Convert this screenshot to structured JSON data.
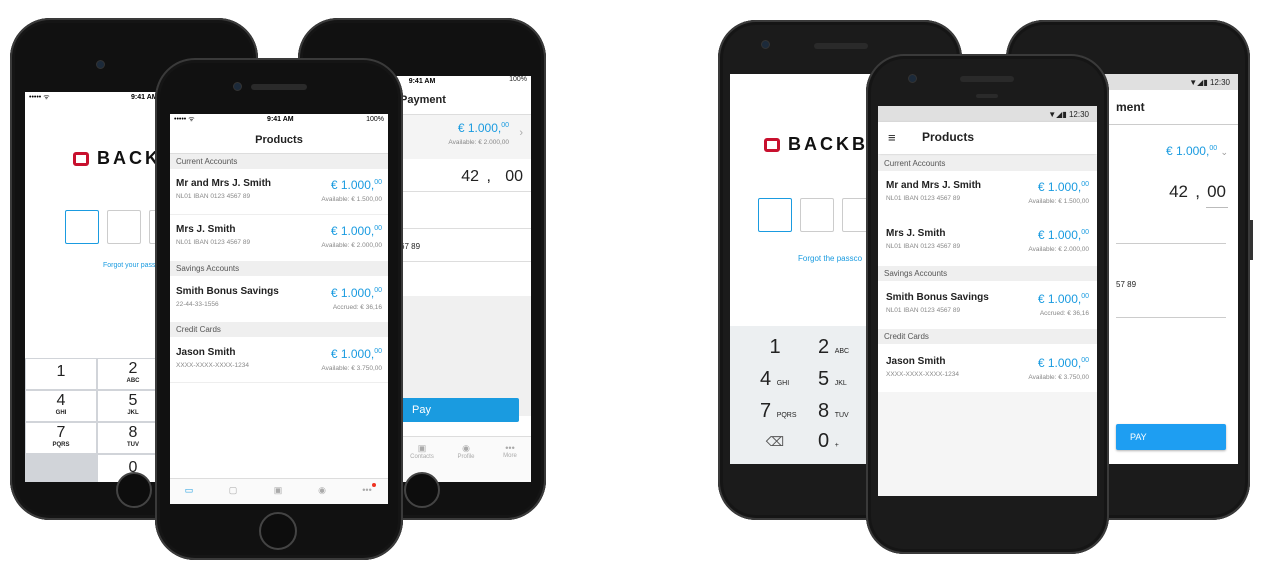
{
  "ios": {
    "status_time": "9:41 AM",
    "status_battery": "100%",
    "login": {
      "brand": "BACKB",
      "forgot": "Forgot your passco"
    },
    "keypad": [
      {
        "d": "1",
        "l": ""
      },
      {
        "d": "2",
        "l": "ABC"
      },
      {
        "d": "4",
        "l": "GHI"
      },
      {
        "d": "5",
        "l": "JKL"
      },
      {
        "d": "7",
        "l": "PQRS"
      },
      {
        "d": "8",
        "l": "TUV"
      },
      {
        "d": "0",
        "l": ""
      }
    ],
    "products": {
      "title": "Products",
      "sections": [
        {
          "label": "Current Accounts",
          "items": [
            {
              "name": "Mr and Mrs J. Smith",
              "sub": "NL01 IBAN 0123 4567 89",
              "amount": "€ 1.000,",
              "cents": "00",
              "avail": "Available: € 1.500,00"
            },
            {
              "name": "Mrs J. Smith",
              "sub": "NL01 IBAN 0123 4567 89",
              "amount": "€ 1.000,",
              "cents": "00",
              "avail": "Available: € 2.000,00"
            }
          ]
        },
        {
          "label": "Savings Accounts",
          "items": [
            {
              "name": "Smith Bonus Savings",
              "sub": "22-44-33-1556",
              "amount": "€ 1.000,",
              "cents": "00",
              "avail": "Accrued: € 36,16"
            }
          ]
        },
        {
          "label": "Credit Cards",
          "items": [
            {
              "name": "Jason Smith",
              "sub": "XXXX-XXXX-XXXX-1234",
              "amount": "€ 1.000,",
              "cents": "00",
              "avail": "Available: € 3.750,00"
            }
          ]
        }
      ]
    },
    "payment": {
      "title": "Payment",
      "amount": "€ 1.000,",
      "cents": "00",
      "avail": "Available: € 2.000,00",
      "entry_int": "42",
      "entry_sep": ",",
      "entry_dec": "00",
      "iban_tail": "67 89",
      "pay": "Pay",
      "tabs": [
        "Contacts",
        "Profile",
        "More"
      ]
    }
  },
  "android": {
    "status_time": "12:30",
    "login": {
      "brand": "BACKB",
      "forgot": "Forgot the passco"
    },
    "keypad": [
      {
        "d": "1",
        "l": ""
      },
      {
        "d": "2",
        "l": "ABC"
      },
      {
        "d": "4",
        "l": "GHI"
      },
      {
        "d": "5",
        "l": "JKL"
      },
      {
        "d": "7",
        "l": "PQRS"
      },
      {
        "d": "8",
        "l": "TUV"
      },
      {
        "d": "0",
        "l": "+"
      }
    ],
    "products": {
      "title": "Products"
    },
    "payment": {
      "title": "ment",
      "amount": "€ 1.000,",
      "cents": "00",
      "entry_int": "42",
      "entry_sep": ",",
      "entry_dec": "00",
      "iban_tail": "57 89",
      "pay": "PAY"
    }
  },
  "colors": {
    "accent": "#1a9be0",
    "brand": "#c8102e"
  }
}
